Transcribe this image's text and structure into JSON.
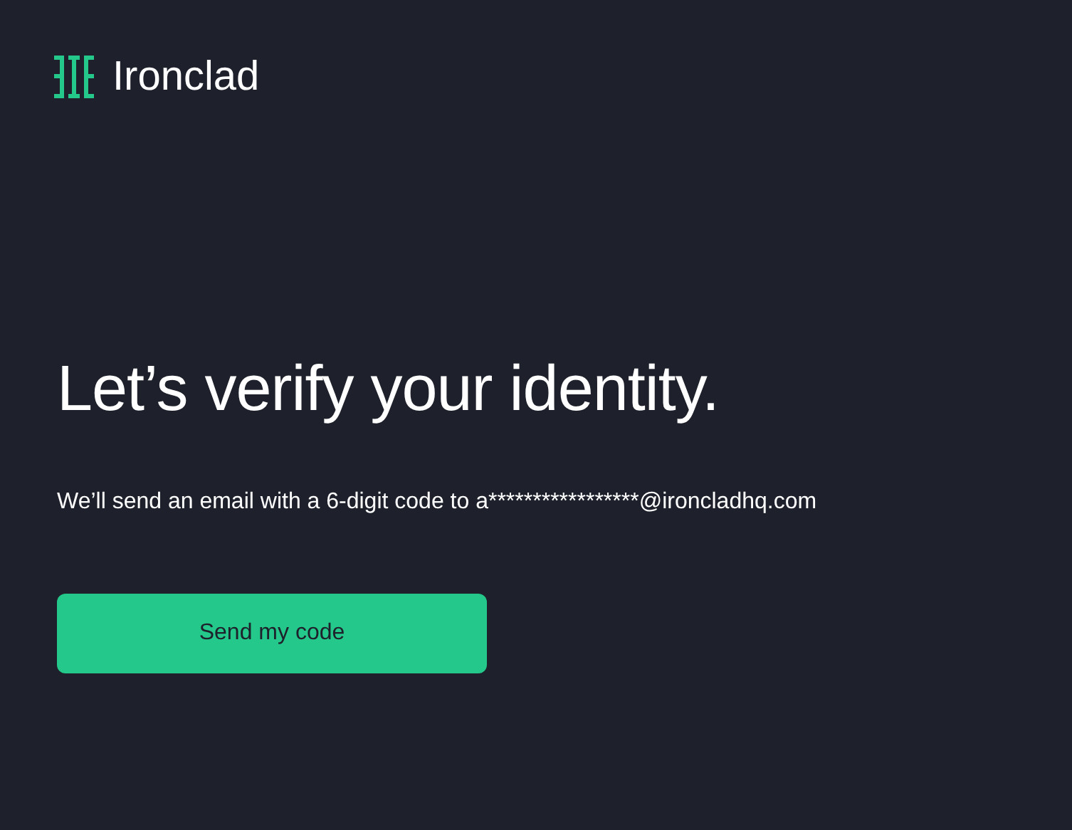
{
  "brand": {
    "name": "Ironclad"
  },
  "heading": "Let’s verify your identity.",
  "message": "We’ll send an email with a 6-digit code to a*****************@ironcladhq.com",
  "buttons": [
    {
      "label": "Send my code",
      "kind": "primary"
    }
  ]
}
